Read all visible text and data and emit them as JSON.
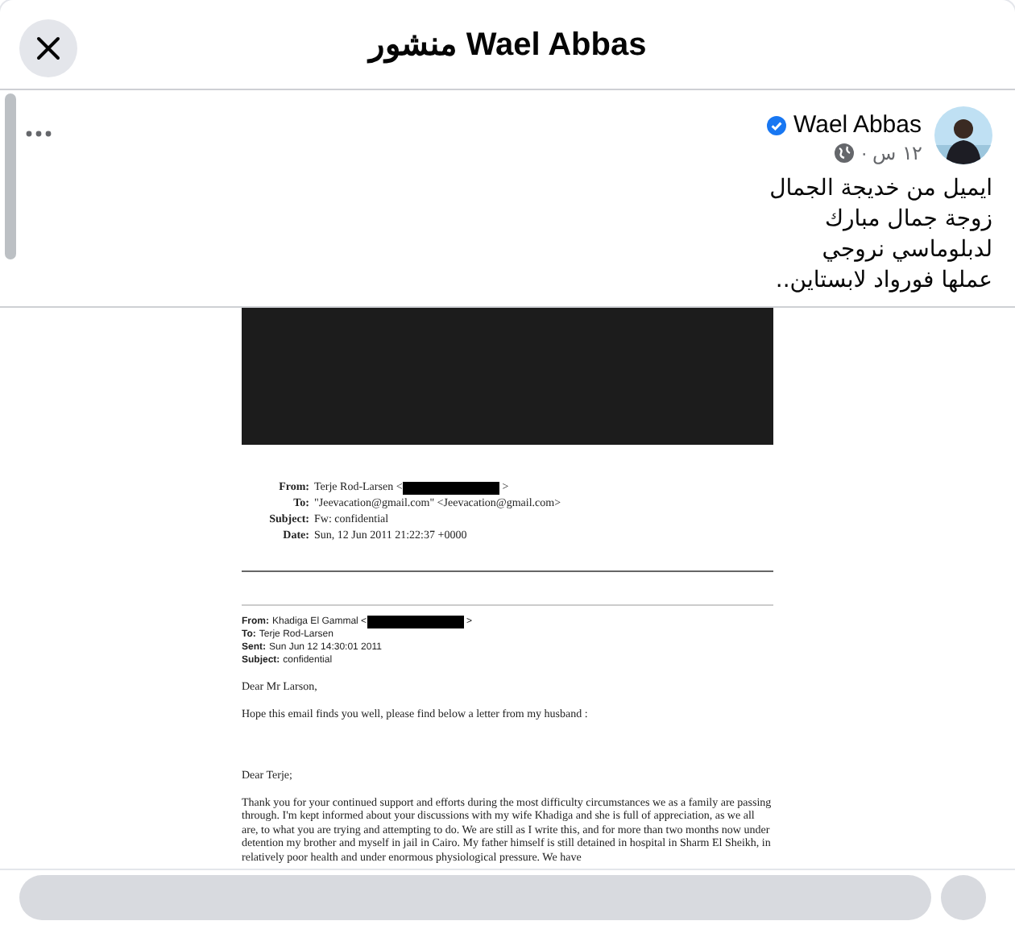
{
  "header": {
    "title": "منشور Wael Abbas"
  },
  "post": {
    "author": "Wael Abbas",
    "verified": true,
    "time": "١٢ س ·",
    "lines": [
      "ايميل من خديجة الجمال",
      "زوجة جمال مبارك",
      "لدبلوماسي نروجي",
      "عملها فورواد لابستاين.."
    ]
  },
  "document": {
    "forward_header": [
      {
        "label": "From:",
        "value": "Terje Rod-Larsen <",
        "redacted": true,
        "after": ">"
      },
      {
        "label": "To:",
        "value": "\"Jeevacation@gmail.com\" <Jeevacation@gmail.com>",
        "redacted": false
      },
      {
        "label": "Subject:",
        "value": "Fw: confidential",
        "redacted": false
      },
      {
        "label": "Date:",
        "value": "Sun, 12 Jun 2011 21:22:37 +0000",
        "redacted": false
      }
    ],
    "original_header": [
      {
        "label": "From:",
        "value": "Khadiga El Gammal <",
        "redacted": true,
        "after": ">"
      },
      {
        "label": "To:",
        "value": "Terje Rod-Larsen",
        "redacted": false
      },
      {
        "label": "Sent:",
        "value": "Sun Jun 12 14:30:01 2011",
        "redacted": false
      },
      {
        "label": "Subject:",
        "value": "confidential",
        "redacted": false
      }
    ],
    "paragraphs": [
      "Dear Mr Larson,",
      "Hope this email finds you well, please find below a letter from my husband :",
      "Dear Terje;",
      "Thank you for your continued support and efforts during the most difficulty circumstances we as a family are passing through.  I'm kept informed about your discussions with my wife Khadiga and she is full of appreciation, as we all are, to what you are trying and attempting to do.  We are still as I write this, and for more than two months now under detention my brother and myself  in jail in Cairo.  My father himself is still detained in hospital in Sharm El Sheikh, in relatively poor health and under enormous physiological pressure.  We have"
    ]
  }
}
